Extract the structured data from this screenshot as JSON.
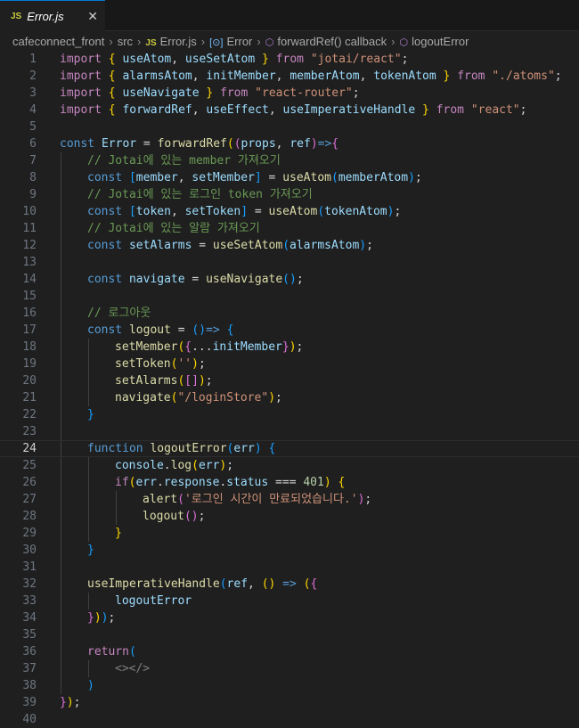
{
  "tab": {
    "badge": "JS",
    "filename": "Error.js",
    "close_glyph": "✕"
  },
  "breadcrumbs": {
    "folder1": "cafeconnect_front",
    "folder2": "src",
    "file_badge": "JS",
    "file": "Error.js",
    "symbol1": "Error",
    "symbol2": "forwardRef() callback",
    "symbol3": "logoutError",
    "separator": "›"
  },
  "editor": {
    "current_line": 24,
    "lines": [
      {
        "n": "1",
        "indent": 0,
        "t": [
          [
            "kw",
            "import "
          ],
          [
            "p1",
            "{ "
          ],
          [
            "va",
            "useAtom"
          ],
          [
            "tx",
            ", "
          ],
          [
            "va",
            "useSetAtom"
          ],
          [
            "p1",
            " }"
          ],
          [
            "kw",
            " from "
          ],
          [
            "str",
            "\"jotai/react\""
          ],
          [
            "tx",
            ";"
          ]
        ]
      },
      {
        "n": "2",
        "indent": 0,
        "t": [
          [
            "kw",
            "import "
          ],
          [
            "p1",
            "{ "
          ],
          [
            "va",
            "alarmsAtom"
          ],
          [
            "tx",
            ", "
          ],
          [
            "va",
            "initMember"
          ],
          [
            "tx",
            ", "
          ],
          [
            "va",
            "memberAtom"
          ],
          [
            "tx",
            ", "
          ],
          [
            "va",
            "tokenAtom"
          ],
          [
            "p1",
            " }"
          ],
          [
            "kw",
            " from "
          ],
          [
            "str",
            "\"./atoms\""
          ],
          [
            "tx",
            ";"
          ]
        ]
      },
      {
        "n": "3",
        "indent": 0,
        "t": [
          [
            "kw",
            "import "
          ],
          [
            "p1",
            "{ "
          ],
          [
            "va",
            "useNavigate"
          ],
          [
            "p1",
            " }"
          ],
          [
            "kw",
            " from "
          ],
          [
            "str",
            "\"react-router\""
          ],
          [
            "tx",
            ";"
          ]
        ]
      },
      {
        "n": "4",
        "indent": 0,
        "t": [
          [
            "kw",
            "import "
          ],
          [
            "p1",
            "{ "
          ],
          [
            "va",
            "forwardRef"
          ],
          [
            "tx",
            ", "
          ],
          [
            "va",
            "useEffect"
          ],
          [
            "tx",
            ", "
          ],
          [
            "va",
            "useImperativeHandle"
          ],
          [
            "p1",
            " }"
          ],
          [
            "kw",
            " from "
          ],
          [
            "str",
            "\"react\""
          ],
          [
            "tx",
            ";"
          ]
        ]
      },
      {
        "n": "5",
        "indent": 0,
        "t": []
      },
      {
        "n": "6",
        "indent": 0,
        "t": [
          [
            "st",
            "const "
          ],
          [
            "va",
            "Error"
          ],
          [
            "tx",
            " = "
          ],
          [
            "fn",
            "forwardRef"
          ],
          [
            "p1",
            "("
          ],
          [
            "p2",
            "("
          ],
          [
            "va",
            "props"
          ],
          [
            "tx",
            ", "
          ],
          [
            "va",
            "ref"
          ],
          [
            "p2",
            ")"
          ],
          [
            "st",
            "=>"
          ],
          [
            "p2",
            "{"
          ]
        ]
      },
      {
        "n": "7",
        "indent": 1,
        "t": [
          [
            "cm",
            "// Jotai에 있는 member 가져오기"
          ]
        ]
      },
      {
        "n": "8",
        "indent": 1,
        "t": [
          [
            "st",
            "const "
          ],
          [
            "p3",
            "["
          ],
          [
            "va",
            "member"
          ],
          [
            "tx",
            ", "
          ],
          [
            "va",
            "setMember"
          ],
          [
            "p3",
            "]"
          ],
          [
            "tx",
            " = "
          ],
          [
            "fn",
            "useAtom"
          ],
          [
            "p3",
            "("
          ],
          [
            "va",
            "memberAtom"
          ],
          [
            "p3",
            ")"
          ],
          [
            "tx",
            ";"
          ]
        ]
      },
      {
        "n": "9",
        "indent": 1,
        "t": [
          [
            "cm",
            "// Jotai에 있는 로그인 token 가져오기"
          ]
        ]
      },
      {
        "n": "10",
        "indent": 1,
        "t": [
          [
            "st",
            "const "
          ],
          [
            "p3",
            "["
          ],
          [
            "va",
            "token"
          ],
          [
            "tx",
            ", "
          ],
          [
            "va",
            "setToken"
          ],
          [
            "p3",
            "]"
          ],
          [
            "tx",
            " = "
          ],
          [
            "fn",
            "useAtom"
          ],
          [
            "p3",
            "("
          ],
          [
            "va",
            "tokenAtom"
          ],
          [
            "p3",
            ")"
          ],
          [
            "tx",
            ";"
          ]
        ]
      },
      {
        "n": "11",
        "indent": 1,
        "t": [
          [
            "cm",
            "// Jotai에 있는 알람 가져오기"
          ]
        ]
      },
      {
        "n": "12",
        "indent": 1,
        "t": [
          [
            "st",
            "const "
          ],
          [
            "va",
            "setAlarms"
          ],
          [
            "tx",
            " = "
          ],
          [
            "fn",
            "useSetAtom"
          ],
          [
            "p3",
            "("
          ],
          [
            "va",
            "alarmsAtom"
          ],
          [
            "p3",
            ")"
          ],
          [
            "tx",
            ";"
          ]
        ]
      },
      {
        "n": "13",
        "indent": 1,
        "t": []
      },
      {
        "n": "14",
        "indent": 1,
        "t": [
          [
            "st",
            "const "
          ],
          [
            "va",
            "navigate"
          ],
          [
            "tx",
            " = "
          ],
          [
            "fn",
            "useNavigate"
          ],
          [
            "p3",
            "()"
          ],
          [
            "tx",
            ";"
          ]
        ]
      },
      {
        "n": "15",
        "indent": 1,
        "t": []
      },
      {
        "n": "16",
        "indent": 1,
        "t": [
          [
            "cm",
            "// 로그아웃"
          ]
        ]
      },
      {
        "n": "17",
        "indent": 1,
        "t": [
          [
            "st",
            "const "
          ],
          [
            "fn",
            "logout"
          ],
          [
            "tx",
            " = "
          ],
          [
            "p3",
            "()"
          ],
          [
            "st",
            "=> "
          ],
          [
            "p3",
            "{"
          ]
        ]
      },
      {
        "n": "18",
        "indent": 2,
        "t": [
          [
            "fn",
            "setMember"
          ],
          [
            "p1",
            "("
          ],
          [
            "p2",
            "{"
          ],
          [
            "tx",
            "..."
          ],
          [
            "va",
            "initMember"
          ],
          [
            "p2",
            "}"
          ],
          [
            "p1",
            ")"
          ],
          [
            "tx",
            ";"
          ]
        ]
      },
      {
        "n": "19",
        "indent": 2,
        "t": [
          [
            "fn",
            "setToken"
          ],
          [
            "p1",
            "("
          ],
          [
            "str",
            "''"
          ],
          [
            "p1",
            ")"
          ],
          [
            "tx",
            ";"
          ]
        ]
      },
      {
        "n": "20",
        "indent": 2,
        "t": [
          [
            "fn",
            "setAlarms"
          ],
          [
            "p1",
            "("
          ],
          [
            "p2",
            "[]"
          ],
          [
            "p1",
            ")"
          ],
          [
            "tx",
            ";"
          ]
        ]
      },
      {
        "n": "21",
        "indent": 2,
        "t": [
          [
            "fn",
            "navigate"
          ],
          [
            "p1",
            "("
          ],
          [
            "str",
            "\"/loginStore\""
          ],
          [
            "p1",
            ")"
          ],
          [
            "tx",
            ";"
          ]
        ]
      },
      {
        "n": "22",
        "indent": 1,
        "t": [
          [
            "p3",
            "}"
          ]
        ]
      },
      {
        "n": "23",
        "indent": 1,
        "t": []
      },
      {
        "n": "24",
        "indent": 1,
        "t": [
          [
            "st",
            "function "
          ],
          [
            "fn",
            "logoutError"
          ],
          [
            "p3",
            "("
          ],
          [
            "va",
            "err"
          ],
          [
            "p3",
            ") {"
          ]
        ]
      },
      {
        "n": "25",
        "indent": 2,
        "t": [
          [
            "va",
            "console"
          ],
          [
            "tx",
            "."
          ],
          [
            "fn",
            "log"
          ],
          [
            "p1",
            "("
          ],
          [
            "va",
            "err"
          ],
          [
            "p1",
            ")"
          ],
          [
            "tx",
            ";"
          ]
        ]
      },
      {
        "n": "26",
        "indent": 2,
        "t": [
          [
            "kw",
            "if"
          ],
          [
            "p1",
            "("
          ],
          [
            "va",
            "err"
          ],
          [
            "tx",
            "."
          ],
          [
            "va",
            "response"
          ],
          [
            "tx",
            "."
          ],
          [
            "va",
            "status"
          ],
          [
            "tx",
            " === "
          ],
          [
            "nu",
            "401"
          ],
          [
            "p1",
            ")"
          ],
          [
            "p1",
            " {"
          ]
        ]
      },
      {
        "n": "27",
        "indent": 3,
        "t": [
          [
            "fn",
            "alert"
          ],
          [
            "p2",
            "("
          ],
          [
            "str",
            "'로그인 시간이 만료되었습니다.'"
          ],
          [
            "p2",
            ")"
          ],
          [
            "tx",
            ";"
          ]
        ]
      },
      {
        "n": "28",
        "indent": 3,
        "t": [
          [
            "fn",
            "logout"
          ],
          [
            "p2",
            "()"
          ],
          [
            "tx",
            ";"
          ]
        ]
      },
      {
        "n": "29",
        "indent": 2,
        "t": [
          [
            "p1",
            "}"
          ]
        ]
      },
      {
        "n": "30",
        "indent": 1,
        "t": [
          [
            "p3",
            "}"
          ]
        ]
      },
      {
        "n": "31",
        "indent": 1,
        "t": []
      },
      {
        "n": "32",
        "indent": 1,
        "t": [
          [
            "fn",
            "useImperativeHandle"
          ],
          [
            "p3",
            "("
          ],
          [
            "va",
            "ref"
          ],
          [
            "tx",
            ", "
          ],
          [
            "p1",
            "()"
          ],
          [
            "st",
            " => "
          ],
          [
            "p1",
            "("
          ],
          [
            "p2",
            "{"
          ]
        ]
      },
      {
        "n": "33",
        "indent": 2,
        "t": [
          [
            "va",
            "logoutError"
          ]
        ]
      },
      {
        "n": "34",
        "indent": 1,
        "t": [
          [
            "p2",
            "}"
          ],
          [
            "p1",
            ")"
          ],
          [
            "p3",
            ")"
          ],
          [
            "tx",
            ";"
          ]
        ]
      },
      {
        "n": "35",
        "indent": 1,
        "t": []
      },
      {
        "n": "36",
        "indent": 1,
        "t": [
          [
            "kw",
            "return"
          ],
          [
            "p3",
            "("
          ]
        ]
      },
      {
        "n": "37",
        "indent": 2,
        "t": [
          [
            "tag",
            "<></>"
          ]
        ]
      },
      {
        "n": "38",
        "indent": 1,
        "t": [
          [
            "p3",
            ")"
          ]
        ]
      },
      {
        "n": "39",
        "indent": 0,
        "t": [
          [
            "p2",
            "}"
          ],
          [
            "p1",
            ")"
          ],
          [
            "tx",
            ";"
          ]
        ]
      },
      {
        "n": "40",
        "indent": 0,
        "t": []
      }
    ]
  }
}
